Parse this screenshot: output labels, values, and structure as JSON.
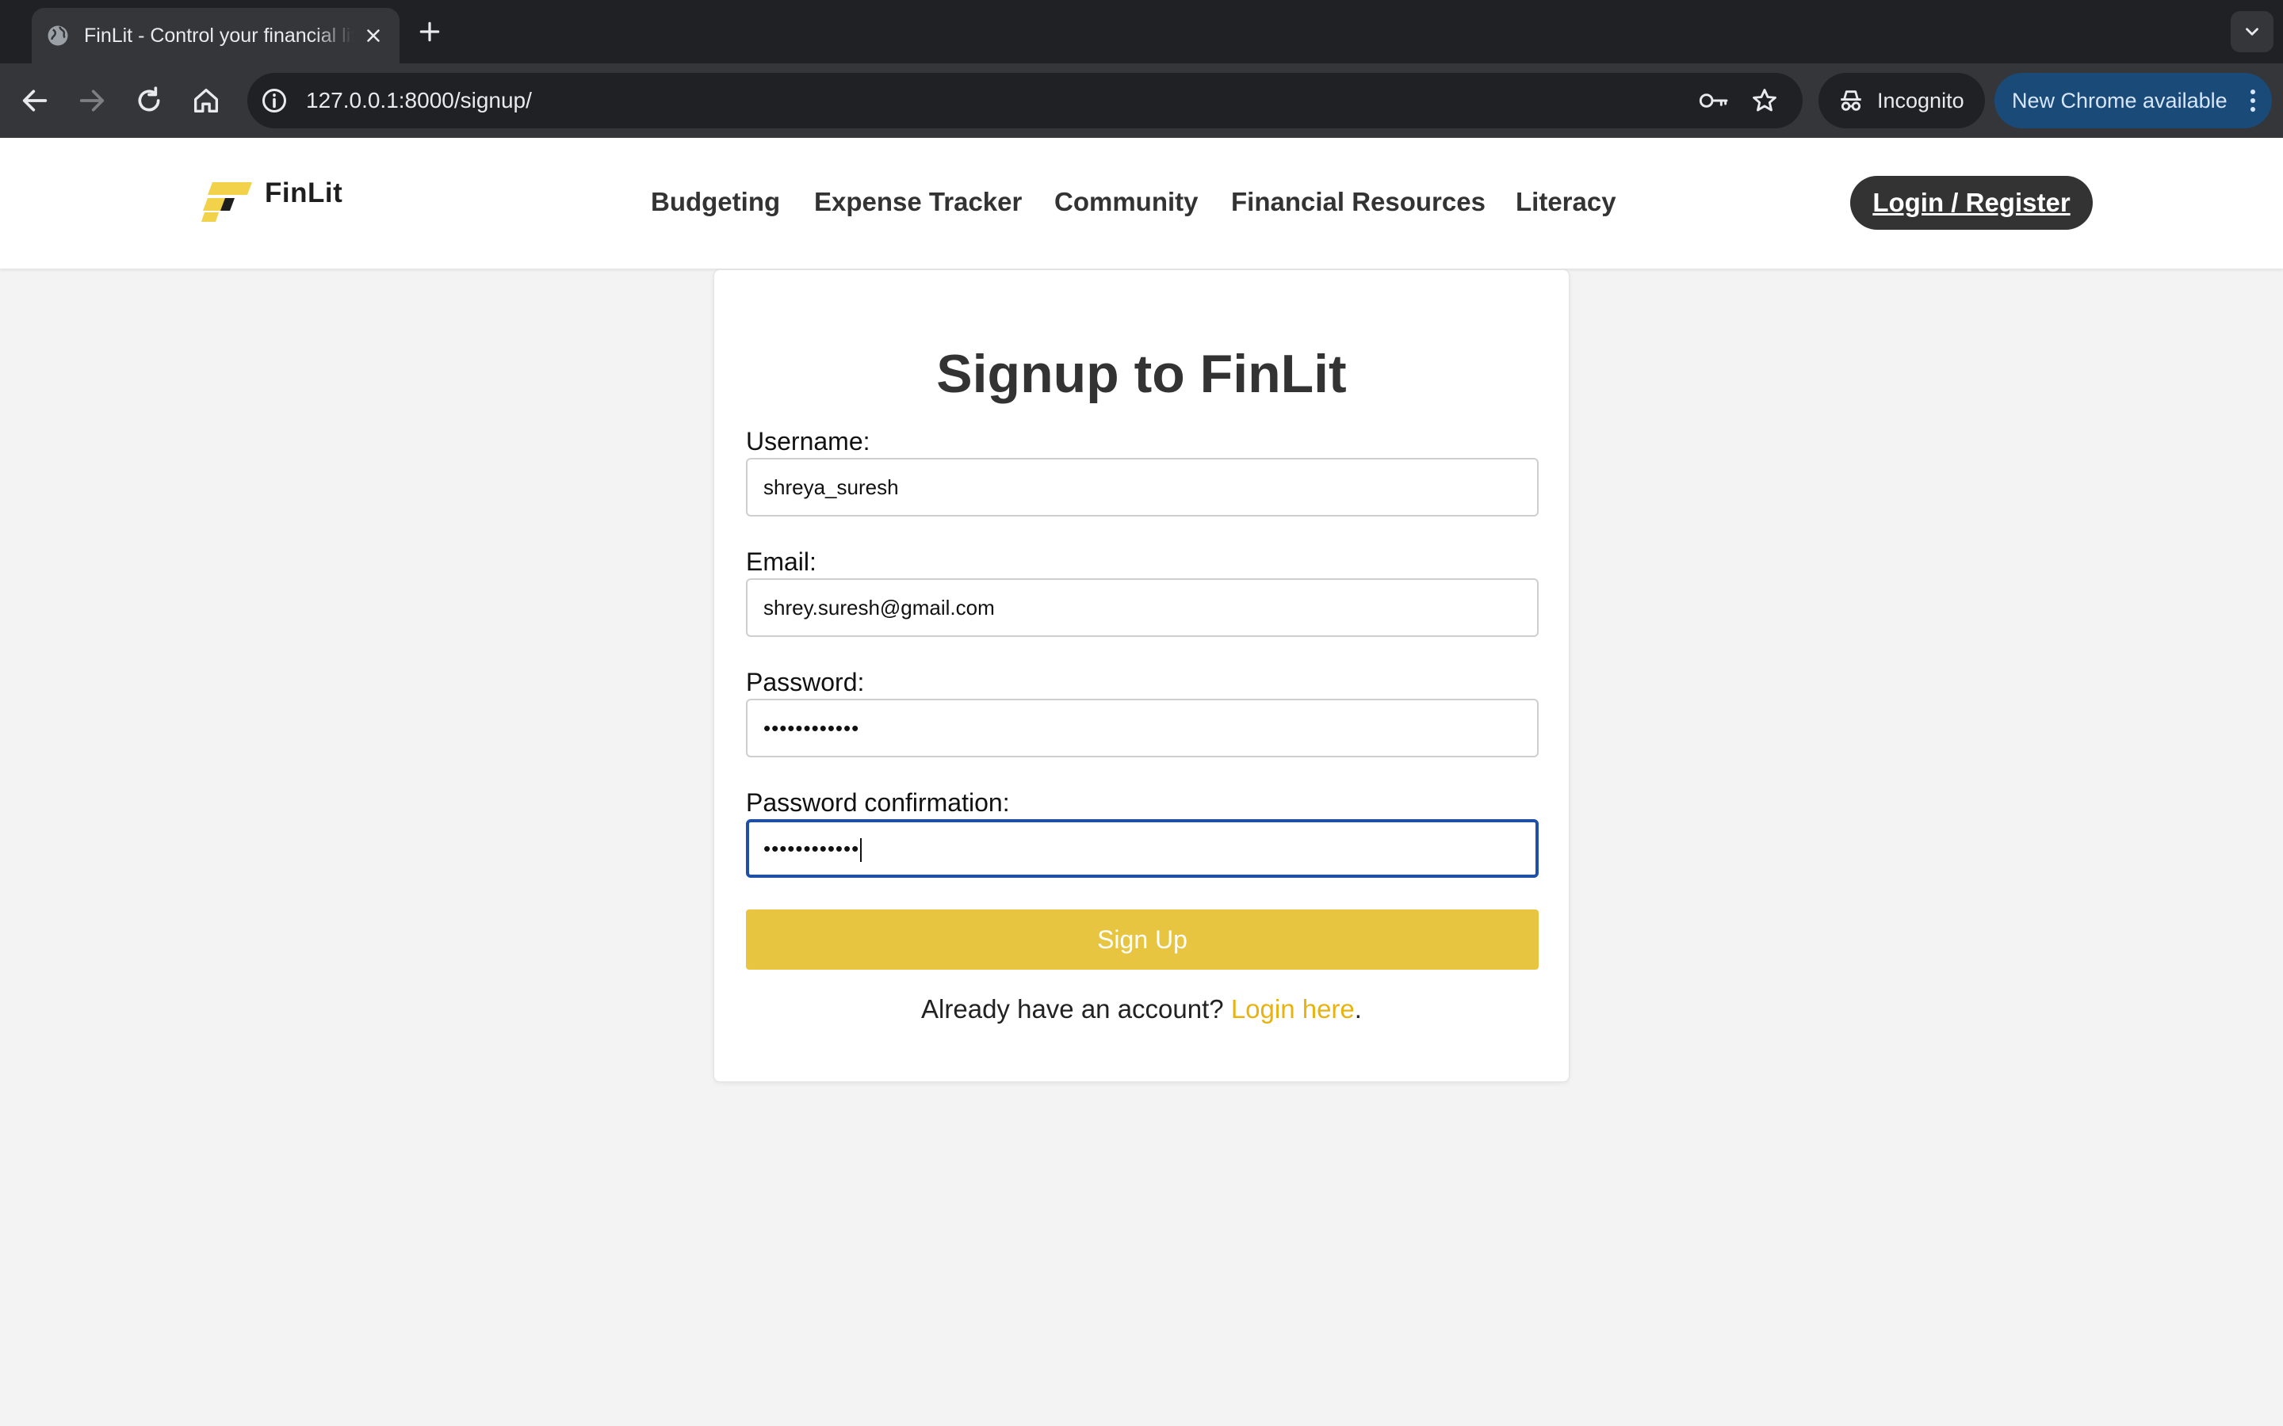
{
  "browser": {
    "tab_title": "FinLit - Control your financial life",
    "url": "127.0.0.1:8000/signup/",
    "incognito_label": "Incognito",
    "update_label": "New Chrome available"
  },
  "header": {
    "brand": "FinLit",
    "nav": [
      "Budgeting",
      "Expense Tracker",
      "Community",
      "Financial Resources",
      "Literacy"
    ],
    "login_button": "Login / Register"
  },
  "form": {
    "title": "Signup to FinLit",
    "username_label": "Username:",
    "username_value": "shreya_suresh",
    "email_label": "Email:",
    "email_value": "shrey.suresh@gmail.com",
    "password_label": "Password:",
    "password_value": "••••••••••••",
    "confirm_label": "Password confirmation:",
    "confirm_value": "••••••••••••",
    "submit_label": "Sign Up",
    "footer_text": "Already have an account?",
    "footer_link": "Login here",
    "footer_end": "."
  },
  "colors": {
    "accent_yellow": "#e8c540",
    "link_yellow": "#e8b30f",
    "focus_blue": "#1f4fa6",
    "dark": "#333333"
  },
  "icons": [
    "globe-icon",
    "close-icon",
    "plus-icon",
    "chevron-down-icon",
    "back-arrow-icon",
    "forward-arrow-icon",
    "reload-icon",
    "home-icon",
    "info-icon",
    "key-icon",
    "star-icon",
    "incognito-icon",
    "more-vert-icon",
    "finlit-logo"
  ]
}
